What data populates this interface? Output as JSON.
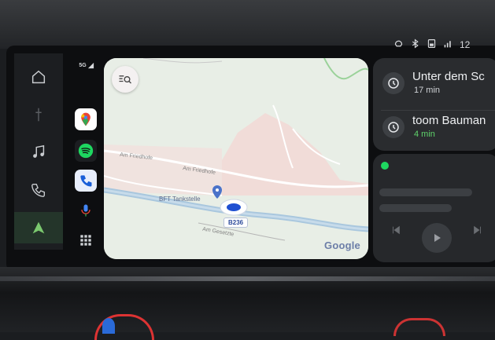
{
  "status_bar": {
    "icons": [
      "wireless-carplay-icon",
      "bluetooth-icon",
      "phone-battery-icon",
      "signal-icon"
    ],
    "time": "12"
  },
  "car_menu": {
    "items": [
      {
        "name": "home-icon"
      },
      {
        "name": "media-icon"
      },
      {
        "name": "phone-icon"
      },
      {
        "name": "android-auto-icon",
        "active": true
      }
    ]
  },
  "dock": {
    "signal": "5G",
    "apps": [
      {
        "name": "google-maps-icon",
        "color": "#ffffff"
      },
      {
        "name": "spotify-icon",
        "color": "#1ed760"
      },
      {
        "name": "phone-app-icon",
        "color": "#e8eefc"
      },
      {
        "name": "assistant-mic-icon",
        "color": "#4285f4"
      },
      {
        "name": "app-launcher-icon",
        "color": "#d0d3d7"
      }
    ]
  },
  "map": {
    "place_label": "BFT Tankstelle",
    "road_label": "B236",
    "street_label_1": "Am Friedhofe",
    "street_label_2": "Am Friedhofe",
    "street_label_3": "Am Gesetzte",
    "attribution": "Google"
  },
  "destinations": [
    {
      "title": "Unter dem Sc",
      "eta": "17 min",
      "eta_color": "#cfd2d6"
    },
    {
      "title": "toom Bauman",
      "eta": "4 min",
      "eta_color": "#5fd36b"
    }
  ],
  "media_card": {
    "app": "spotify-icon",
    "controls": [
      "previous-icon",
      "play-icon",
      "next-icon"
    ]
  },
  "colors": {
    "accent_green": "#5fd36b",
    "spotify_green": "#1ed760",
    "map_bg": "#e6ece4"
  }
}
